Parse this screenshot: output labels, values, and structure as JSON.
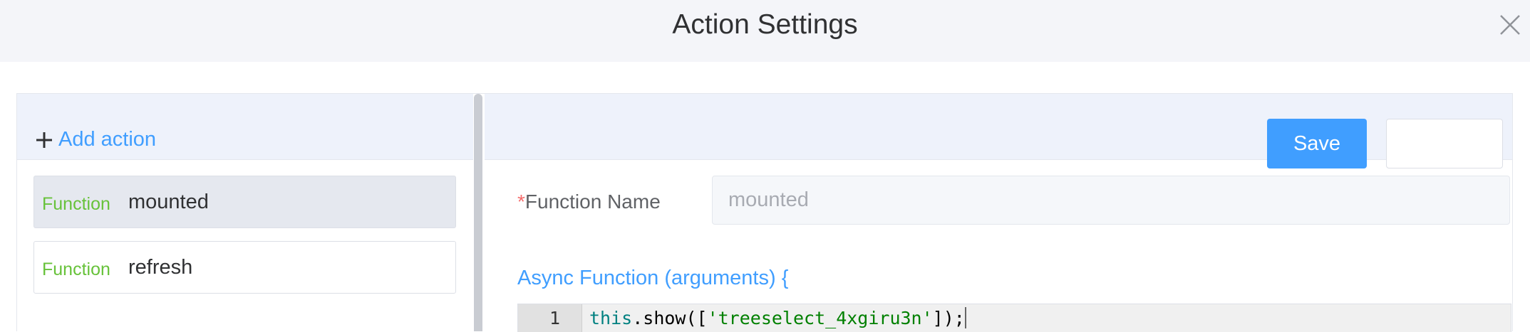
{
  "dialog": {
    "title": "Action Settings",
    "close_icon": "close-icon"
  },
  "actions_panel": {
    "add_label": "Add action",
    "add_icon": "plus-icon",
    "items": [
      {
        "type": "Function",
        "name": "mounted",
        "selected": true
      },
      {
        "type": "Function",
        "name": "refresh",
        "selected": false
      }
    ]
  },
  "editor": {
    "save_label": "Save",
    "secondary_label": "",
    "function_name_label": "Function Name",
    "required_mark": "*",
    "function_name_value": "mounted",
    "async_signature": "Async Function (arguments) {",
    "code_lines": [
      {
        "number": "1",
        "keyword": "this",
        "before_string": ".show([",
        "string": "'treeselect_4xgiru3n'",
        "after_string": "]);"
      }
    ]
  },
  "colors": {
    "accent": "#409eff",
    "function_tag": "#67c23a",
    "required": "#f56c6c",
    "header_bg": "#f4f5f9",
    "toolbar_bg": "#eef2fb"
  }
}
